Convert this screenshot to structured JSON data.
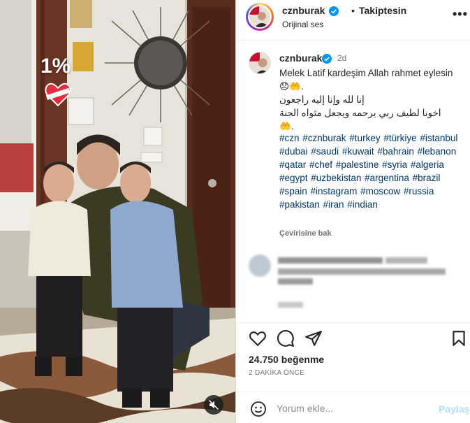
{
  "media": {
    "overlay_percent": "1%"
  },
  "header": {
    "username": "cznburak",
    "separator": "•",
    "follow_status": "Takiptesin",
    "audio_label": "Orijinal ses",
    "more_icon": "more-horizontal-icon"
  },
  "caption": {
    "username": "cznburak",
    "time_ago": "2d",
    "line1": "Melek Latif kardeşim Allah rahmet eylesin😞🤲.",
    "line_ar1": "إنا لله وإنا إليه راجعون",
    "line_ar2": "اخونا لطيف ربي يرحمه ويجعل مثواه الجنة",
    "line_end": "🤲.",
    "hashtags": "#czn #cznburak #turkey #türkiye #istanbul #dubai #saudi #kuwait #bahrain #lebanon #qatar #chef #palestine #syria #algeria #egypt #uzbekistan #argentina #brazil #spain #instagram #moscow #russia #pakistan #iran #indian",
    "see_translation": "Çevirisine bak"
  },
  "actions": {
    "like_icon": "heart-outline-icon",
    "comment_icon": "comment-bubble-icon",
    "share_icon": "paper-plane-icon",
    "save_icon": "bookmark-icon"
  },
  "stats": {
    "likes": "24.750 beğenme",
    "posted": "2 DAKİKA ÖNCE"
  },
  "comment_box": {
    "placeholder": "Yorum ekle...",
    "post_label": "Paylaş"
  },
  "colors": {
    "link": "#00376b",
    "verified": "#0095f6",
    "post_disabled": "#b2dffc"
  }
}
